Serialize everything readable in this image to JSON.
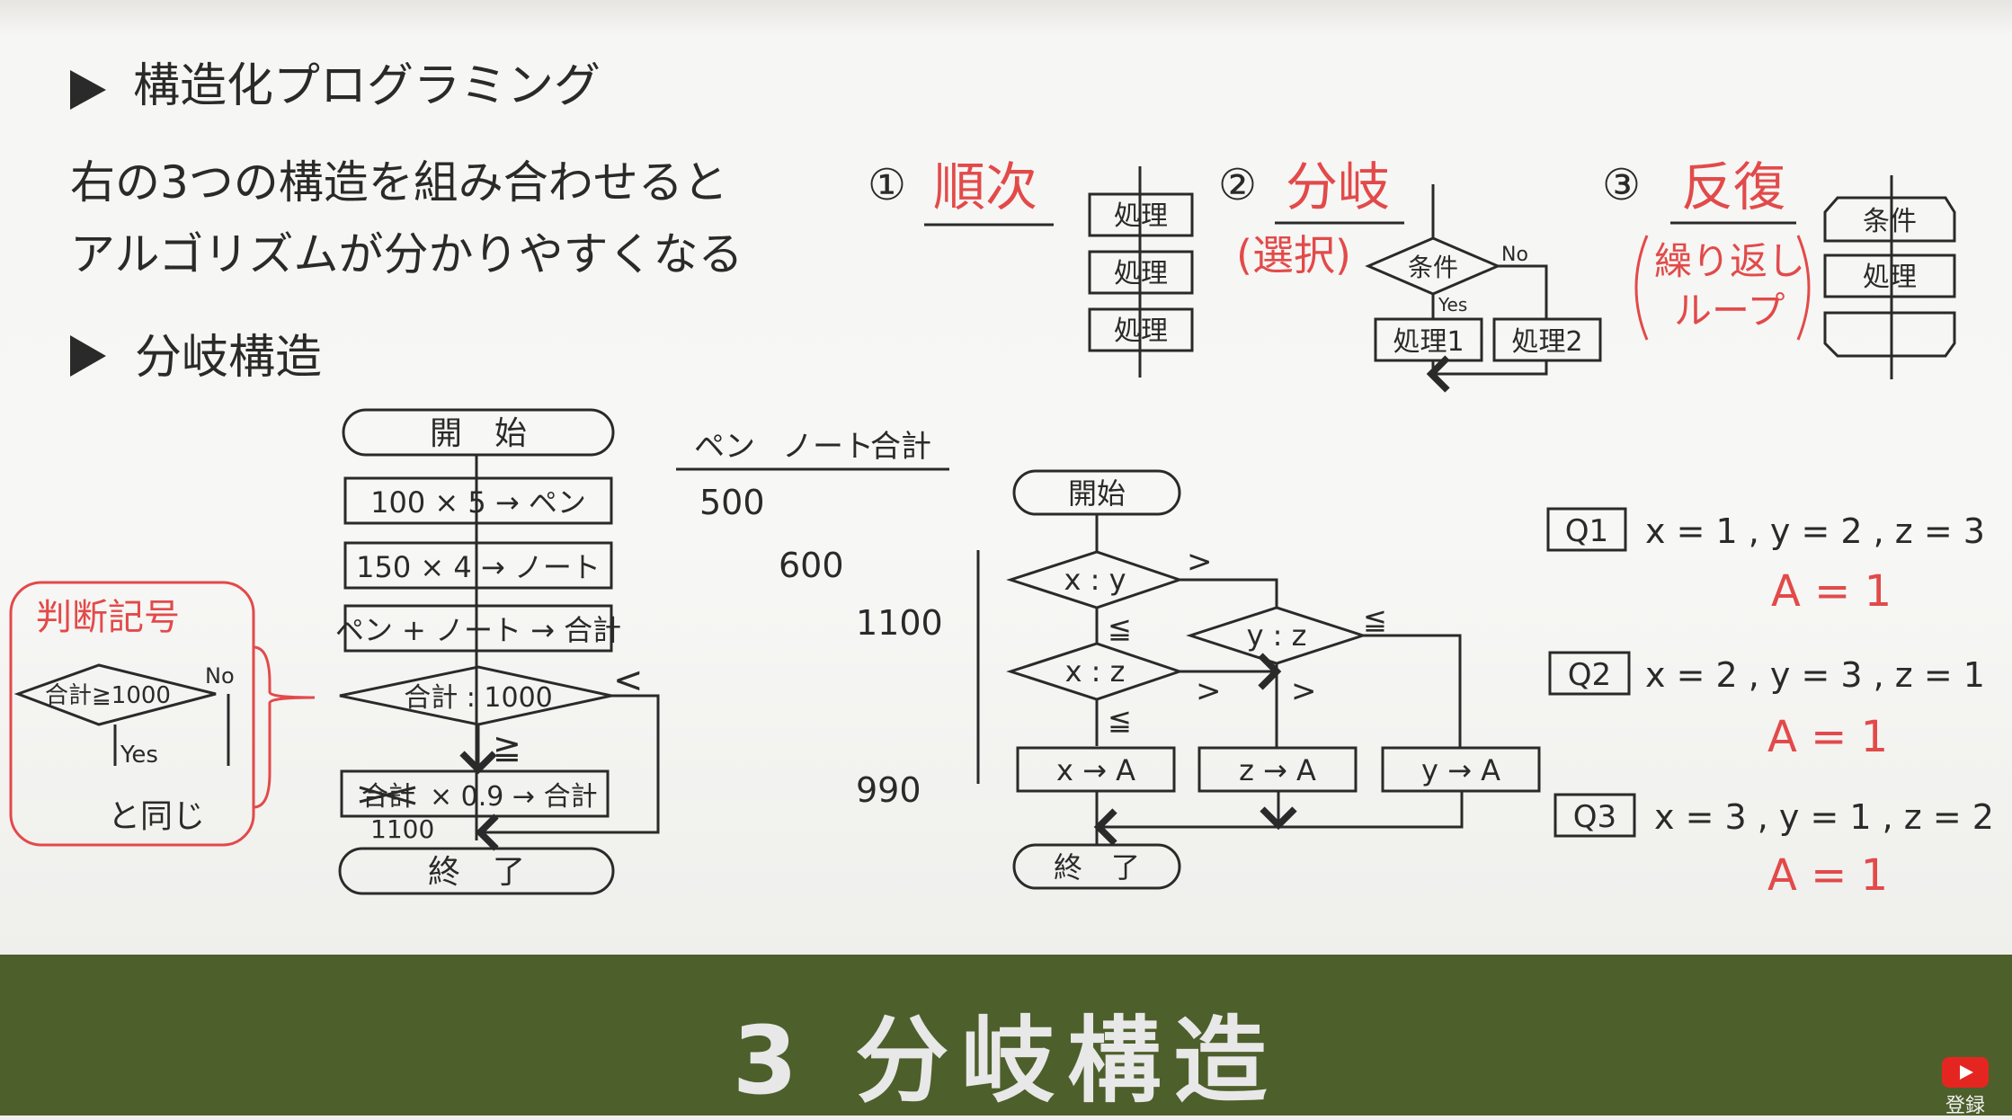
{
  "header": {
    "structured_title": "構造化プログラミング",
    "intro_line1": "右の3つの構造を組み合わせると",
    "intro_line2": "アルゴリズムが分かりやすくなる",
    "branch_title": "分岐構造"
  },
  "structures": {
    "sequence": {
      "number": "①",
      "title": "順次",
      "boxes": [
        "処理",
        "処理",
        "処理"
      ]
    },
    "branch": {
      "number": "②",
      "title": "分岐",
      "subtitle": "(選択)",
      "condition": "条件",
      "no": "No",
      "yes": "Yes",
      "process1": "処理1",
      "process2": "処理2"
    },
    "loop": {
      "number": "③",
      "title": "反復",
      "sub1": "繰り返し",
      "sub2": "ループ",
      "condition": "条件",
      "process": "処理"
    }
  },
  "judgment_note": {
    "title": "判断記号",
    "condition": "合計≧1000",
    "no": "No",
    "yes": "Yes",
    "same": "と同じ"
  },
  "flow1": {
    "start": "開　始",
    "step1": "100 × 5 → ペン",
    "step2": "150 × 4 → ノート",
    "step3": "ペン + ノート → 合計",
    "decision": "合計 : 1000",
    "lt": "<",
    "ge": "≧",
    "step4_struck": "合計",
    "step4": "× 0.9 → 合計",
    "value_note": "1100",
    "end": "終　了"
  },
  "trace_table": {
    "headers": [
      "ペン",
      "ノート",
      "合計"
    ],
    "values": [
      "500",
      "600",
      "1100",
      "990"
    ]
  },
  "flow2": {
    "start": "開始",
    "d1": "x : y",
    "d2": "x : z",
    "d3": "y : z",
    "gt": ">",
    "le": "≦",
    "box1": "x → A",
    "box2": "z → A",
    "box3": "y → A",
    "end": "終　了"
  },
  "questions": [
    {
      "label": "Q1",
      "vars": "x = 1 , y = 2 , z = 3",
      "answer": "A = 1"
    },
    {
      "label": "Q2",
      "vars": "x = 2 , y = 3 , z = 1",
      "answer": "A = 1"
    },
    {
      "label": "Q3",
      "vars": "x = 3 , y = 1 , z = 2",
      "answer": "A = 1"
    }
  ],
  "banner": {
    "title": "3 分岐構造"
  },
  "subscribe": {
    "label": "登録"
  },
  "colors": {
    "ink": "#2a2a2a",
    "red": "#e24a4a",
    "banner": "#4d5f2b"
  }
}
